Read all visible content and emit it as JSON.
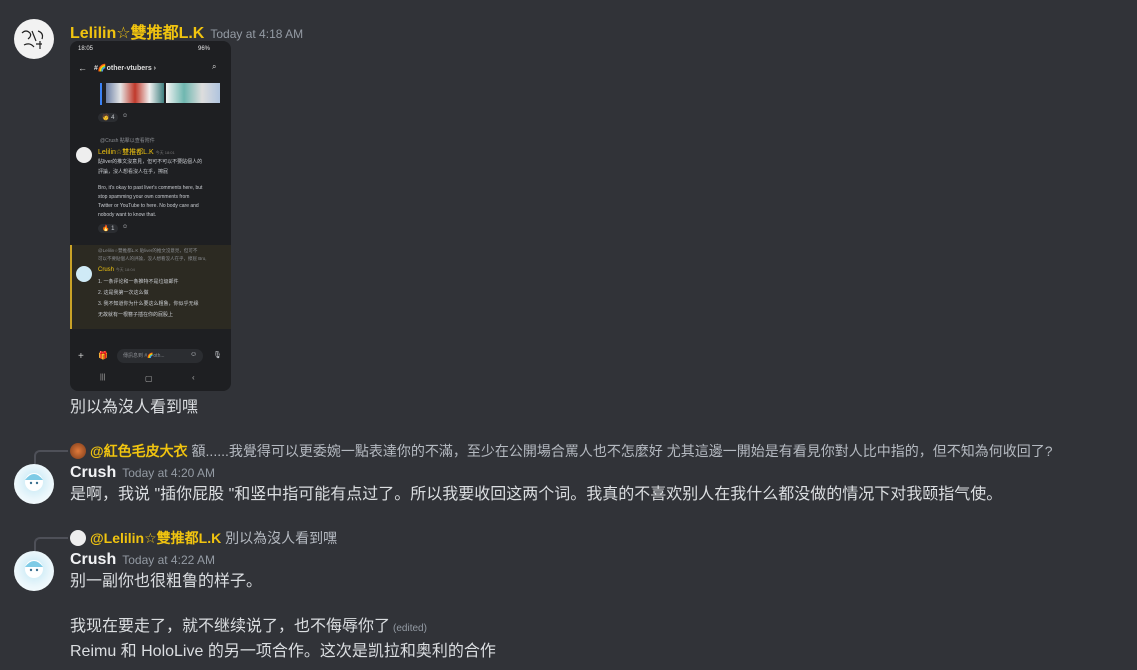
{
  "messages": [
    {
      "author": "Lelilin☆雙推都L.K",
      "timestamp": "Today at 4:18 AM",
      "avatar_text": "多不傻\n愛推",
      "text": "別以為沒人看到嘿"
    },
    {
      "reply_to": {
        "author": "@紅色毛皮大衣",
        "text": "額......我覺得可以更委婉一點表達你的不滿，至少在公開場合罵人也不怎麼好 尤其這邊一開始是有看見你對人比中指的，但不知為何收回了?"
      },
      "author": "Crush",
      "timestamp": "Today at 4:20 AM",
      "text": "是啊，我说 \"插你屁股 \"和竖中指可能有点过了。所以我要收回这两个词。我真的不喜欢别人在我什么都没做的情况下对我颐指气使。"
    },
    {
      "reply_to": {
        "author": "@Lelilin☆雙推都L.K",
        "text": "別以為沒人看到嘿"
      },
      "author": "Crush",
      "timestamp": "Today at 4:22 AM",
      "text": "别一副你也很粗鲁的样子。",
      "extra_lines": [
        " 我现在要走了，就不继续说了，也不侮辱你了",
        "Reimu 和 HoloLive 的另一项合作。这次是凯拉和奥利的合作"
      ],
      "edited_label": "(edited)"
    }
  ],
  "phone_screenshot": {
    "status_time": "18:05",
    "status_right": "96%",
    "channel": "other-vtubers",
    "reactions_top": [
      "4"
    ],
    "reply_hint": "@Crush 點擊以查看附件",
    "msg_author": "Lelilin☆雙推都L.K",
    "msg_time": "今天 18:01",
    "msg_lines": [
      "貼liver的推文沒意見，但可不可以不要貼個人的",
      "評論，沒人想看沒人在乎，擦屁"
    ],
    "msg_en": [
      "Bro, it's okay to past liver's comments here, but",
      "stop spamming your own comments from",
      "Twitter or YouTube to here. No body  care and",
      "nobody want to know that."
    ],
    "reaction_mid": "1",
    "reply2": "@Lelilin☆雙推都L.K 貼liver的推文沒意見，但可不",
    "reply2b": "可以不要貼個人的評論，沒人想看沒人在乎，擦屁 Bro,",
    "crush_author": "Crush",
    "crush_time": "今天 18:04",
    "crush_list": [
      "1.  一条评论和一条推特不是垃圾邮件",
      "2.  这是我第一次这么做",
      "3.  我不知道你为什么要这么粗鲁，你似乎无缘",
      "    无故就有一根簪子插在你的屁股上"
    ],
    "input_placeholder": "傳訊息到 #🌈oth..."
  }
}
